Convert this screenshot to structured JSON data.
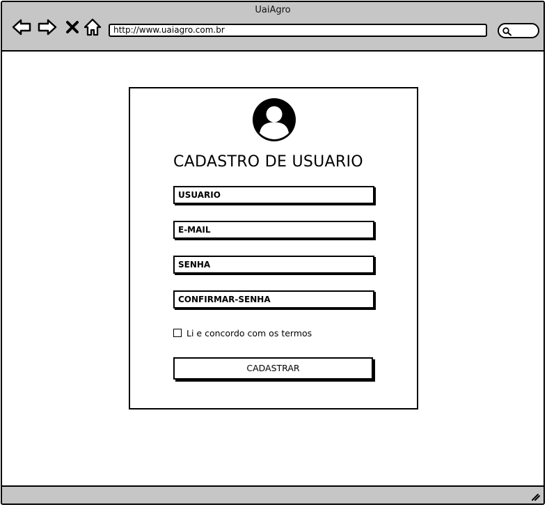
{
  "window": {
    "title": "UaiAgro"
  },
  "browser": {
    "url": "http://www.uaiagro.com.br",
    "nav_icons": [
      "back-arrow-icon",
      "forward-arrow-icon",
      "close-x-icon",
      "home-icon"
    ],
    "search_icon": "magnifier-icon"
  },
  "form": {
    "avatar_icon": "user-avatar-icon",
    "title": "CADASTRO DE USUARIO",
    "fields": {
      "usuario": "USUARIO",
      "email": "E-MAIL",
      "senha": "SENHA",
      "confirmar_senha": "CONFIRMAR-SENHA"
    },
    "terms_label": "Li e concordo com os termos",
    "terms_checked": false,
    "submit_label": "CADASTRAR"
  },
  "colors": {
    "chrome": "#c6c6c6",
    "stroke": "#000000",
    "background": "#ffffff"
  }
}
